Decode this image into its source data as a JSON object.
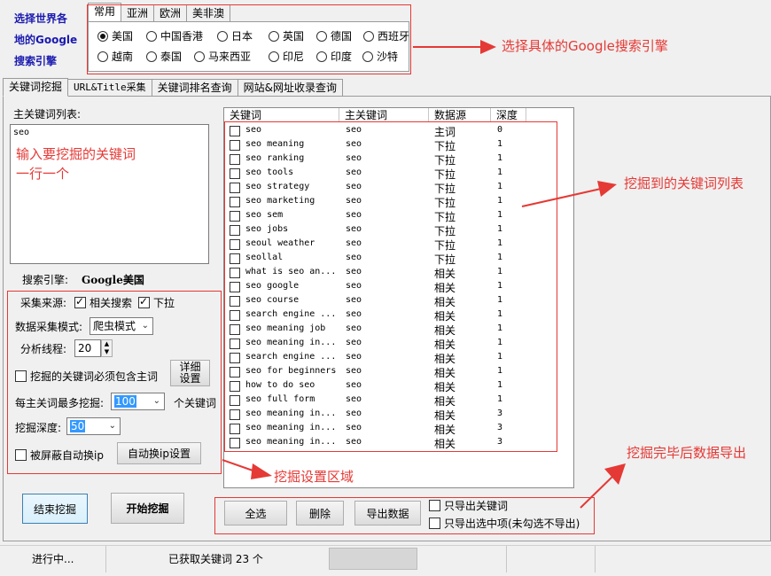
{
  "engine_label": {
    "line1": "选择世界各",
    "line2": "地的Google",
    "line3": "搜索引擎"
  },
  "region_tabs": [
    "常用",
    "亚洲",
    "欧洲",
    "美非澳"
  ],
  "radios_row1": [
    {
      "label": "美国",
      "checked": true
    },
    {
      "label": "中国香港",
      "checked": false
    },
    {
      "label": "日本",
      "checked": false
    },
    {
      "label": "英国",
      "checked": false
    },
    {
      "label": "德国",
      "checked": false
    },
    {
      "label": "西班牙",
      "checked": false
    }
  ],
  "radios_row2": [
    {
      "label": "越南",
      "checked": false
    },
    {
      "label": "泰国",
      "checked": false
    },
    {
      "label": "马来西亚",
      "checked": false
    },
    {
      "label": "印尼",
      "checked": false
    },
    {
      "label": "印度",
      "checked": false
    },
    {
      "label": "沙特",
      "checked": false
    }
  ],
  "main_tabs": [
    "关键词挖掘",
    "URL&Title采集",
    "关键词排名查询",
    "网站&网址收录查询"
  ],
  "main_keywords_label": "主关键词列表:",
  "main_keywords_value": "seo",
  "search_engine_label": "搜索引擎:",
  "search_engine_value": "Google美国",
  "source_label": "采集来源:",
  "source_related": "相关搜索",
  "source_dropdown": "下拉",
  "mode_label": "数据采集模式:",
  "mode_value": "爬虫模式",
  "threads_label": "分析线程:",
  "threads_value": "20",
  "must_contain_label": "挖掘的关键词必须包含主词",
  "detail_button": "详细\n设置",
  "max_label": "每主关词最多挖掘:",
  "max_value": "100",
  "max_unit": "个关键词",
  "depth_label": "挖掘深度:",
  "depth_value": "50",
  "auto_ip_label": "被屏蔽自动换ip",
  "auto_ip_button": "自动换ip设置",
  "stop_button": "结束挖掘",
  "start_button": "开始挖掘",
  "table_headers": [
    "关键词",
    "主关键词",
    "数据源",
    "深度"
  ],
  "rows": [
    [
      "seo",
      "seo",
      "主词",
      "0"
    ],
    [
      "seo meaning",
      "seo",
      "下拉",
      "1"
    ],
    [
      "seo ranking",
      "seo",
      "下拉",
      "1"
    ],
    [
      "seo tools",
      "seo",
      "下拉",
      "1"
    ],
    [
      "seo strategy",
      "seo",
      "下拉",
      "1"
    ],
    [
      "seo marketing",
      "seo",
      "下拉",
      "1"
    ],
    [
      "seo sem",
      "seo",
      "下拉",
      "1"
    ],
    [
      "seo jobs",
      "seo",
      "下拉",
      "1"
    ],
    [
      "seoul weather",
      "seo",
      "下拉",
      "1"
    ],
    [
      "seollal",
      "seo",
      "下拉",
      "1"
    ],
    [
      "what is seo an...",
      "seo",
      "相关",
      "1"
    ],
    [
      "seo google",
      "seo",
      "相关",
      "1"
    ],
    [
      "seo course",
      "seo",
      "相关",
      "1"
    ],
    [
      "search engine ...",
      "seo",
      "相关",
      "1"
    ],
    [
      "seo meaning job",
      "seo",
      "相关",
      "1"
    ],
    [
      "seo meaning in...",
      "seo",
      "相关",
      "1"
    ],
    [
      "search engine ...",
      "seo",
      "相关",
      "1"
    ],
    [
      "seo for beginners",
      "seo",
      "相关",
      "1"
    ],
    [
      "how to do seo",
      "seo",
      "相关",
      "1"
    ],
    [
      "seo full form",
      "seo",
      "相关",
      "1"
    ],
    [
      "seo meaning in...",
      "seo",
      "相关",
      "3"
    ],
    [
      "seo meaning in...",
      "seo",
      "相关",
      "3"
    ],
    [
      "seo meaning in...",
      "seo",
      "相关",
      "3"
    ]
  ],
  "export": {
    "select_all": "全选",
    "delete": "删除",
    "export": "导出数据",
    "only_keywords": "只导出关键词",
    "only_selected": "只导出选中项(未勾选不导出)"
  },
  "status": {
    "state": "进行中...",
    "count": "已获取关键词 23 个"
  },
  "annotations": {
    "engine": "选择具体的Google搜索引擎",
    "input_line1": "输入要挖掘的关键词",
    "input_line2": "一行一个",
    "list": "挖掘到的关键词列表",
    "settings": "挖掘设置区域",
    "export": "挖掘完毕后数据导出"
  },
  "colors": {
    "annotation": "#e53935",
    "label_blue": "#1a1ab0",
    "selection": "#3399ff"
  }
}
